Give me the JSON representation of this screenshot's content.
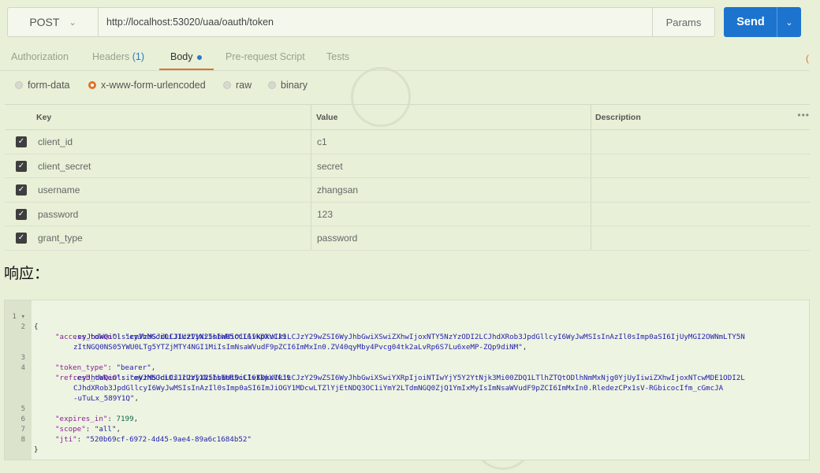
{
  "request": {
    "method": "POST",
    "url": "http://localhost:53020/uaa/oauth/token",
    "params_label": "Params",
    "send_label": "Send"
  },
  "tabs": [
    {
      "label": "Authorization"
    },
    {
      "label": "Headers",
      "count": "(1)"
    },
    {
      "label": "Body",
      "active": true
    },
    {
      "label": "Pre-request Script"
    },
    {
      "label": "Tests"
    }
  ],
  "body_types": [
    {
      "label": "form-data",
      "selected": false
    },
    {
      "label": "x-www-form-urlencoded",
      "selected": true
    },
    {
      "label": "raw",
      "selected": false
    },
    {
      "label": "binary",
      "selected": false
    }
  ],
  "table": {
    "headers": {
      "key": "Key",
      "value": "Value",
      "description": "Description"
    },
    "more": "•••",
    "rows": [
      {
        "key": "client_id",
        "value": "c1"
      },
      {
        "key": "client_secret",
        "value": "secret"
      },
      {
        "key": "username",
        "value": "zhangsan"
      },
      {
        "key": "password",
        "value": "123"
      },
      {
        "key": "grant_type",
        "value": "password"
      }
    ]
  },
  "response_heading": "响应：",
  "response": {
    "line_numbers": [
      "1",
      "2",
      "3",
      "4",
      "5",
      "6",
      "7",
      "8"
    ],
    "open_brace": "{",
    "close_brace": "}",
    "access_token_key": "\"access_token\"",
    "access_token_1": "\"eyJhbGciOiJIUzI1NiIsInR5cCI6IkpXVCJ9",
    "access_token_2": ".eyJhdWQiOlsicmVzMSJdLCJ1c2VyX25hbWUiOiLlvKDkuIkiLCJzY29wZSI6WyJhbGwiXSwiZXhwIjoxNTY5NzYzODI2LCJhdXRob3JpdGllcyI6WyJwMSIsInAzIl0sImp0aSI6IjUyMGI2OWNmLTY5N",
    "access_token_3": "zItNGQ0NS05YWU0LTg5YTZjMTY4NGI1MiIsImNsaWVudF9pZCI6ImMxIn0.ZV40qyMby4Pvcg04tk2aLvRp6S7Lu6xeMP-ZQp9diNM\"",
    "token_type_key": "\"token_type\"",
    "token_type_val": "\"bearer\"",
    "refresh_token_key": "\"refresh_token\"",
    "refresh_token_1": "\"eyJhbGciOiJIUzI1NiIsInR5cCI6IkpXVCJ9",
    "refresh_token_2": ".eyJhdWQiOlsicmVzMSJdLCJ1c2VyX25hbWUiOiLlvKDkuIkiLCJzY29wZSI6WyJhbGwiXSwiYXRpIjoiNTIwYjY5Y2YtNjk3Mi00ZDQ1LTlhZTQtODlhNmMxNjg0YjUyIiwiZXhwIjoxNTcwMDE1ODI2L",
    "refresh_token_3": "CJhdXRob3JpdGllcyI6WyJwMSIsInAzIl0sImp0aSI6ImJiOGY1MDcwLTZlYjEtNDQ3OC1iYmY2LTdmNGQ0ZjQ1YmIxMyIsImNsaWVudF9pZCI6ImMxIn0.RledezCPx1sV-RGbicocIfm_cGmcJA",
    "refresh_token_4": "-uTuLx_589Y1Q\"",
    "expires_in_key": "\"expires_in\"",
    "expires_in_val": "7199",
    "scope_key": "\"scope\"",
    "scope_val": "\"all\"",
    "jti_key": "\"jti\"",
    "jti_val": "\"520b69cf-6972-4d45-9ae4-89a6c1684b52\"",
    "colon": ": ",
    "comma": ","
  }
}
